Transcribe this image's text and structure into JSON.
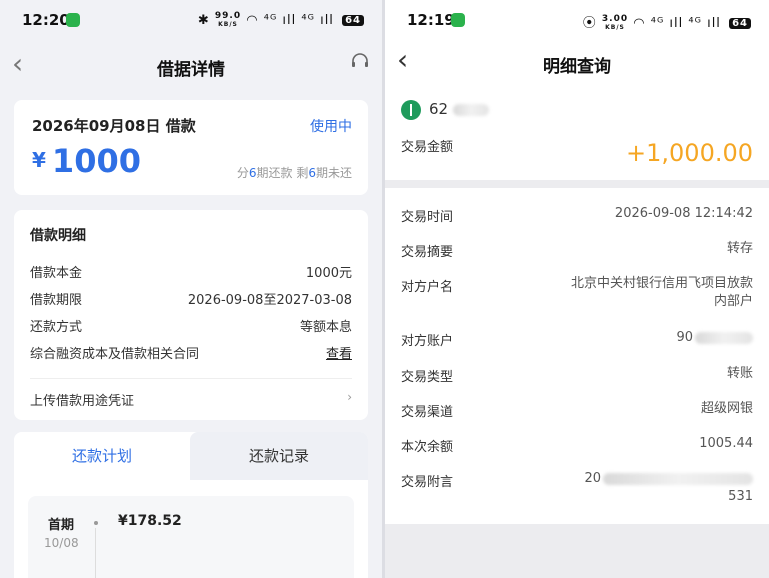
{
  "left": {
    "status_time": "12:20",
    "net_speed": "99.0",
    "net_unit": "KB/S",
    "signal": "⁴ᴳ ıll ⁴ᴳ ıll",
    "battery": "64",
    "nav_title": "借据详情",
    "summary": {
      "date_label": "2026年09月08日 借款",
      "status": "使用中",
      "currency": "¥",
      "amount": "1000",
      "period_prefix": "分",
      "period_total": "6",
      "period_mid": "期还款 剩",
      "period_remaining": "6",
      "period_suffix": "期未还"
    },
    "details": {
      "title": "借款明细",
      "rows": [
        {
          "label": "借款本金",
          "value": "1000元"
        },
        {
          "label": "借款期限",
          "value": "2026-09-08至2027-03-08"
        },
        {
          "label": "还款方式",
          "value": "等额本息"
        },
        {
          "label": "综合融资成本及借款相关合同",
          "value": "查看"
        }
      ],
      "upload_label": "上传借款用途凭证",
      "chevron": "›"
    },
    "tabs": {
      "active": "还款计划",
      "inactive": "还款记录"
    },
    "plan": [
      {
        "name": "首期",
        "date": "10/08",
        "amount": "¥178.52"
      }
    ]
  },
  "right": {
    "status_time": "12:19",
    "net_speed": "3.00",
    "net_unit": "KB/S",
    "signal": "⁴ᴳ ıll ⁴ᴳ ıll",
    "battery": "64",
    "nav_title": "明细查询",
    "account_prefix": "62",
    "amount_label": "交易金额",
    "amount": "+1,000.00",
    "rows": [
      {
        "label": "交易时间",
        "value": "2026-09-08 12:14:42"
      },
      {
        "label": "交易摘要",
        "value": "转存"
      },
      {
        "label": "对方户名",
        "value": "北京中关村银行信用飞项目放款",
        "value2": "内部户"
      },
      {
        "label": "对方账户",
        "value": "90"
      },
      {
        "label": "交易类型",
        "value": "转账"
      },
      {
        "label": "交易渠道",
        "value": "超级网银"
      },
      {
        "label": "本次余额",
        "value": "1005.44"
      },
      {
        "label": "交易附言",
        "value": "20",
        "value2": "531"
      }
    ]
  },
  "colors": {
    "accent_blue": "#2f6fe4",
    "amount_orange": "#f5a623",
    "wechat_green": "#2bb24c"
  }
}
